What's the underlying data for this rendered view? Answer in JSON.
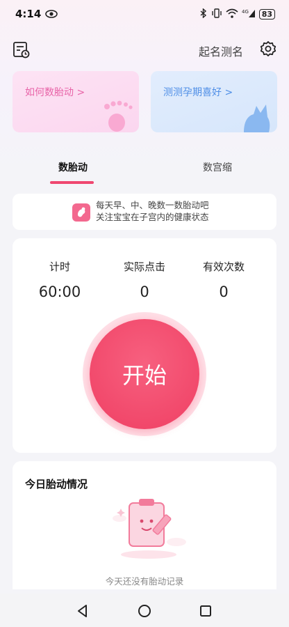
{
  "status_bar": {
    "time": "4:14",
    "battery": "83"
  },
  "header": {
    "naming_label": "起名测名"
  },
  "cards": {
    "fetal_movement_guide": "如何数胎动 >",
    "pregnancy_preference": "测测孕期喜好 >"
  },
  "tabs": {
    "active": "数胎动",
    "inactive": "数宫缩"
  },
  "tip": {
    "line1": "每天早、中、晚数一数胎动吧",
    "line2": "关注宝宝在子宫内的健康状态"
  },
  "counter": {
    "timer_label": "计时",
    "timer_value": "60:00",
    "clicks_label": "实际点击",
    "clicks_value": "0",
    "valid_label": "有效次数",
    "valid_value": "0",
    "start_label": "开始"
  },
  "today": {
    "title": "今日胎动情况",
    "empty_text": "今天还没有胎动记录"
  },
  "colors": {
    "accent": "#ef4770",
    "pink_card": "#fbd6ef",
    "blue_card": "#d6e6fb"
  }
}
